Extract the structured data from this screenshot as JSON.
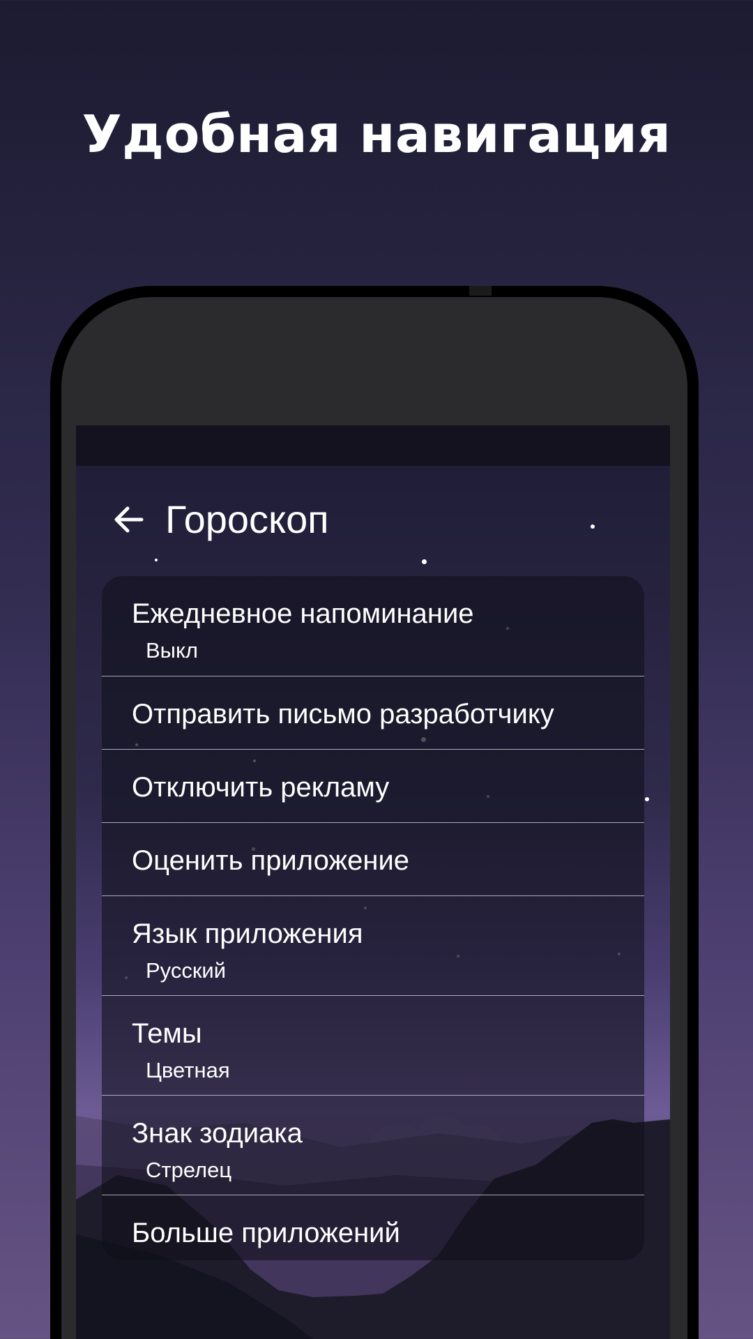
{
  "headline": "Удобная навигация",
  "app_bar": {
    "title": "Гороскоп",
    "back_icon": "arrow-left-icon"
  },
  "settings": [
    {
      "id": "daily-reminder",
      "title": "Ежедневное напоминание",
      "subtitle": "Выкл"
    },
    {
      "id": "email-developer",
      "title": "Отправить письмо разработчику"
    },
    {
      "id": "disable-ads",
      "title": "Отключить рекламу"
    },
    {
      "id": "rate-app",
      "title": "Оценить приложение"
    },
    {
      "id": "app-language",
      "title": "Язык приложения",
      "subtitle": "Русский"
    },
    {
      "id": "themes",
      "title": "Темы",
      "subtitle": "Цветная"
    },
    {
      "id": "zodiac-sign",
      "title": "Знак зодиака",
      "subtitle": "Стрелец"
    },
    {
      "id": "more-apps",
      "title": "Больше приложений"
    }
  ],
  "colors": {
    "background_top": "#1c1b31",
    "background_bottom": "#655383",
    "text": "#ffffff",
    "card": "#100f1a",
    "phone_frame": "#000000",
    "phone_body": "#2b2b2d"
  }
}
